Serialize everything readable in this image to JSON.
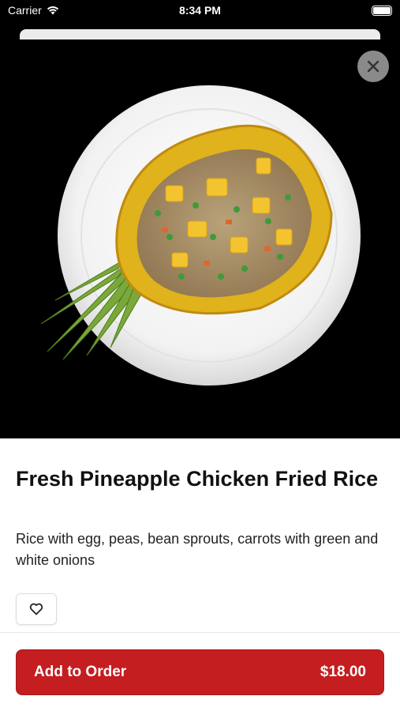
{
  "status_bar": {
    "carrier": "Carrier",
    "time": "8:34 PM"
  },
  "hero": {
    "image_alt": "pineapple chicken fried rice on plate",
    "close_icon": "close-icon"
  },
  "item": {
    "title": "Fresh Pineapple Chicken Fried Rice",
    "description": "Rice with egg, peas, bean sprouts, carrots with green and white onions"
  },
  "actions": {
    "favorite_icon": "heart-icon",
    "add_label": "Add to Order",
    "price": "$18.00"
  },
  "colors": {
    "accent": "#c41e20",
    "background": "#000000"
  }
}
